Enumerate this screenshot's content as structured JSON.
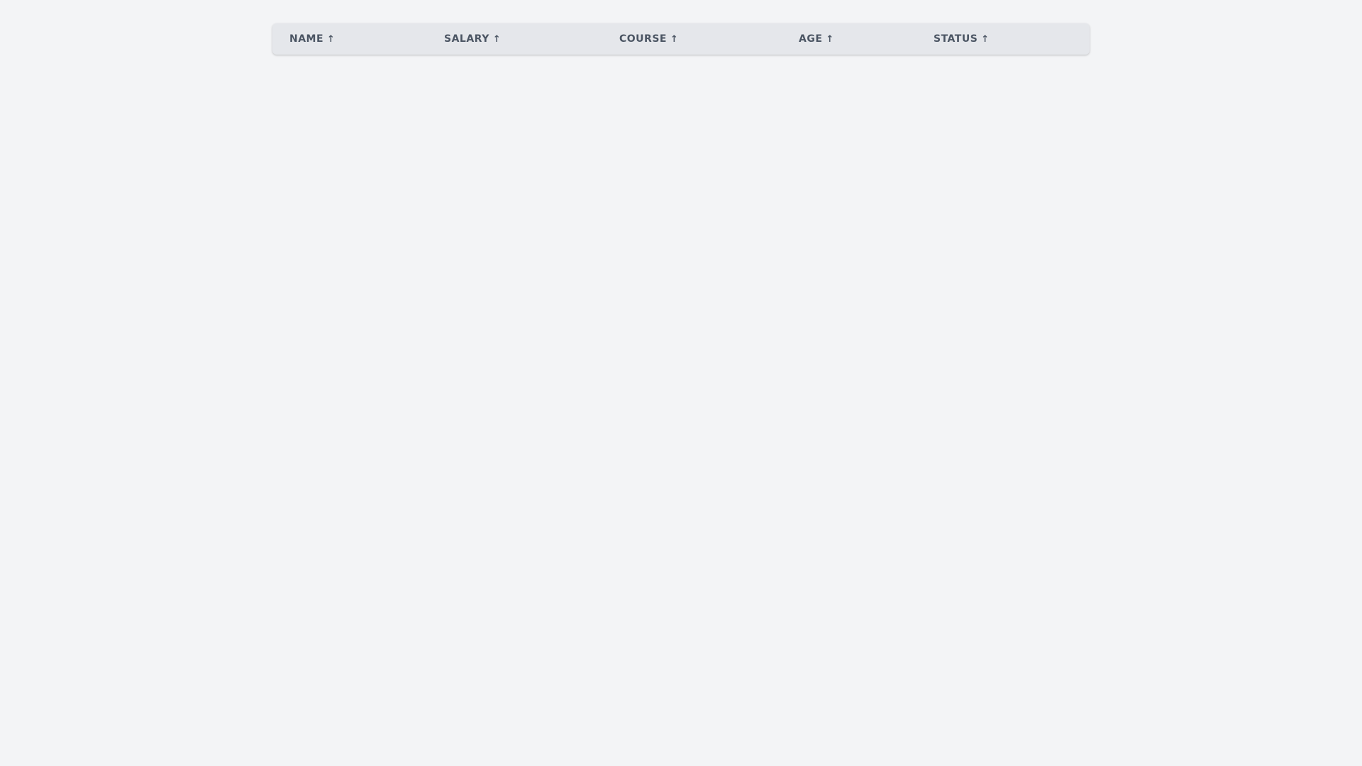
{
  "table": {
    "columns": [
      {
        "label": "NAME",
        "sort_icon": "↑"
      },
      {
        "label": "SALARY",
        "sort_icon": "↑"
      },
      {
        "label": "COURSE",
        "sort_icon": "↑"
      },
      {
        "label": "AGE",
        "sort_icon": "↑"
      },
      {
        "label": "STATUS",
        "sort_icon": "↑"
      }
    ],
    "rows": []
  },
  "colors": {
    "background": "#f3f4f6",
    "header_background": "#e5e7eb",
    "header_text": "#4b5563"
  }
}
